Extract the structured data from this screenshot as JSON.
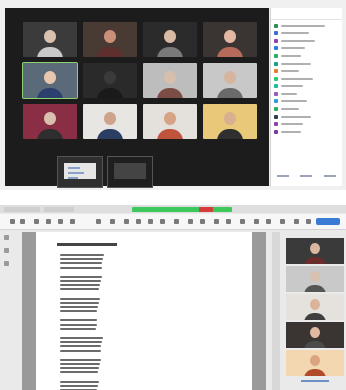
{
  "meeting": {
    "gallery_tiles": [
      {
        "bg": "#3b3b3b",
        "skin": "#d9c2b0",
        "shirt": "#c9c9c9",
        "active": false
      },
      {
        "bg": "#4a3a34",
        "skin": "#c98f78",
        "shirt": "#5e2f2c",
        "active": false
      },
      {
        "bg": "#2b2b2b",
        "skin": "#d7b9a4",
        "shirt": "#7a7a7a",
        "active": false
      },
      {
        "bg": "#3a3533",
        "skin": "#e2b8a3",
        "shirt": "#b66a5a",
        "active": false
      },
      {
        "bg": "#5a6a78",
        "skin": "#e8c7ae",
        "shirt": "#2d3f6e",
        "active": true
      },
      {
        "bg": "#2a2a2a",
        "skin": "#3a3a3a",
        "shirt": "#1a1a1a",
        "active": false
      },
      {
        "bg": "#bdbdbd",
        "skin": "#d7bfae",
        "shirt": "#7b4d44",
        "active": false
      },
      {
        "bg": "#c8c8c8",
        "skin": "#d6b49e",
        "shirt": "#6a6a6a",
        "active": false
      },
      {
        "bg": "#8a2e45",
        "skin": "#d8bfae",
        "shirt": "#2e2e2e",
        "active": false
      },
      {
        "bg": "#e8e6e2",
        "skin": "#cfa389",
        "shirt": "#2c3e63",
        "active": false
      },
      {
        "bg": "#e4e0dc",
        "skin": "#d7a386",
        "shirt": "#c0533c",
        "active": false
      },
      {
        "bg": "#e8c879",
        "skin": "#d8b08f",
        "shirt": "#2f2f2f",
        "active": false
      }
    ],
    "participants": [
      {
        "color": "#2e8b57",
        "len": 44
      },
      {
        "color": "#3a6fd8",
        "len": 28
      },
      {
        "color": "#8e44ad",
        "len": 34
      },
      {
        "color": "#2c7be5",
        "len": 24
      },
      {
        "color": "#27ae60",
        "len": 20
      },
      {
        "color": "#16a085",
        "len": 30
      },
      {
        "color": "#e67e22",
        "len": 18
      },
      {
        "color": "#2ecc71",
        "len": 32
      },
      {
        "color": "#1abc9c",
        "len": 22
      },
      {
        "color": "#9b59b6",
        "len": 16
      },
      {
        "color": "#3498db",
        "len": 26
      },
      {
        "color": "#27ae60",
        "len": 18
      },
      {
        "color": "#2c3e50",
        "len": 30
      },
      {
        "color": "#8e44ad",
        "len": 22
      },
      {
        "color": "#7d3c98",
        "len": 20
      }
    ]
  },
  "viewer": {
    "thumbnails": [
      {
        "bg": "#3a3a3a",
        "skin": "#d9b7a1",
        "shirt": "#6b2c2c"
      },
      {
        "bg": "#c9c9c9",
        "skin": "#d8c1b0",
        "shirt": "#555555"
      },
      {
        "bg": "#e5e1dc",
        "skin": "#dcb49b",
        "shirt": "#3f3f3f"
      },
      {
        "bg": "#3a3533",
        "skin": "#e2b8a3",
        "shirt": "#4b4b4b"
      },
      {
        "bg": "#f2d7b0",
        "skin": "#d9a47f",
        "shirt": "#b24a2c"
      }
    ]
  }
}
